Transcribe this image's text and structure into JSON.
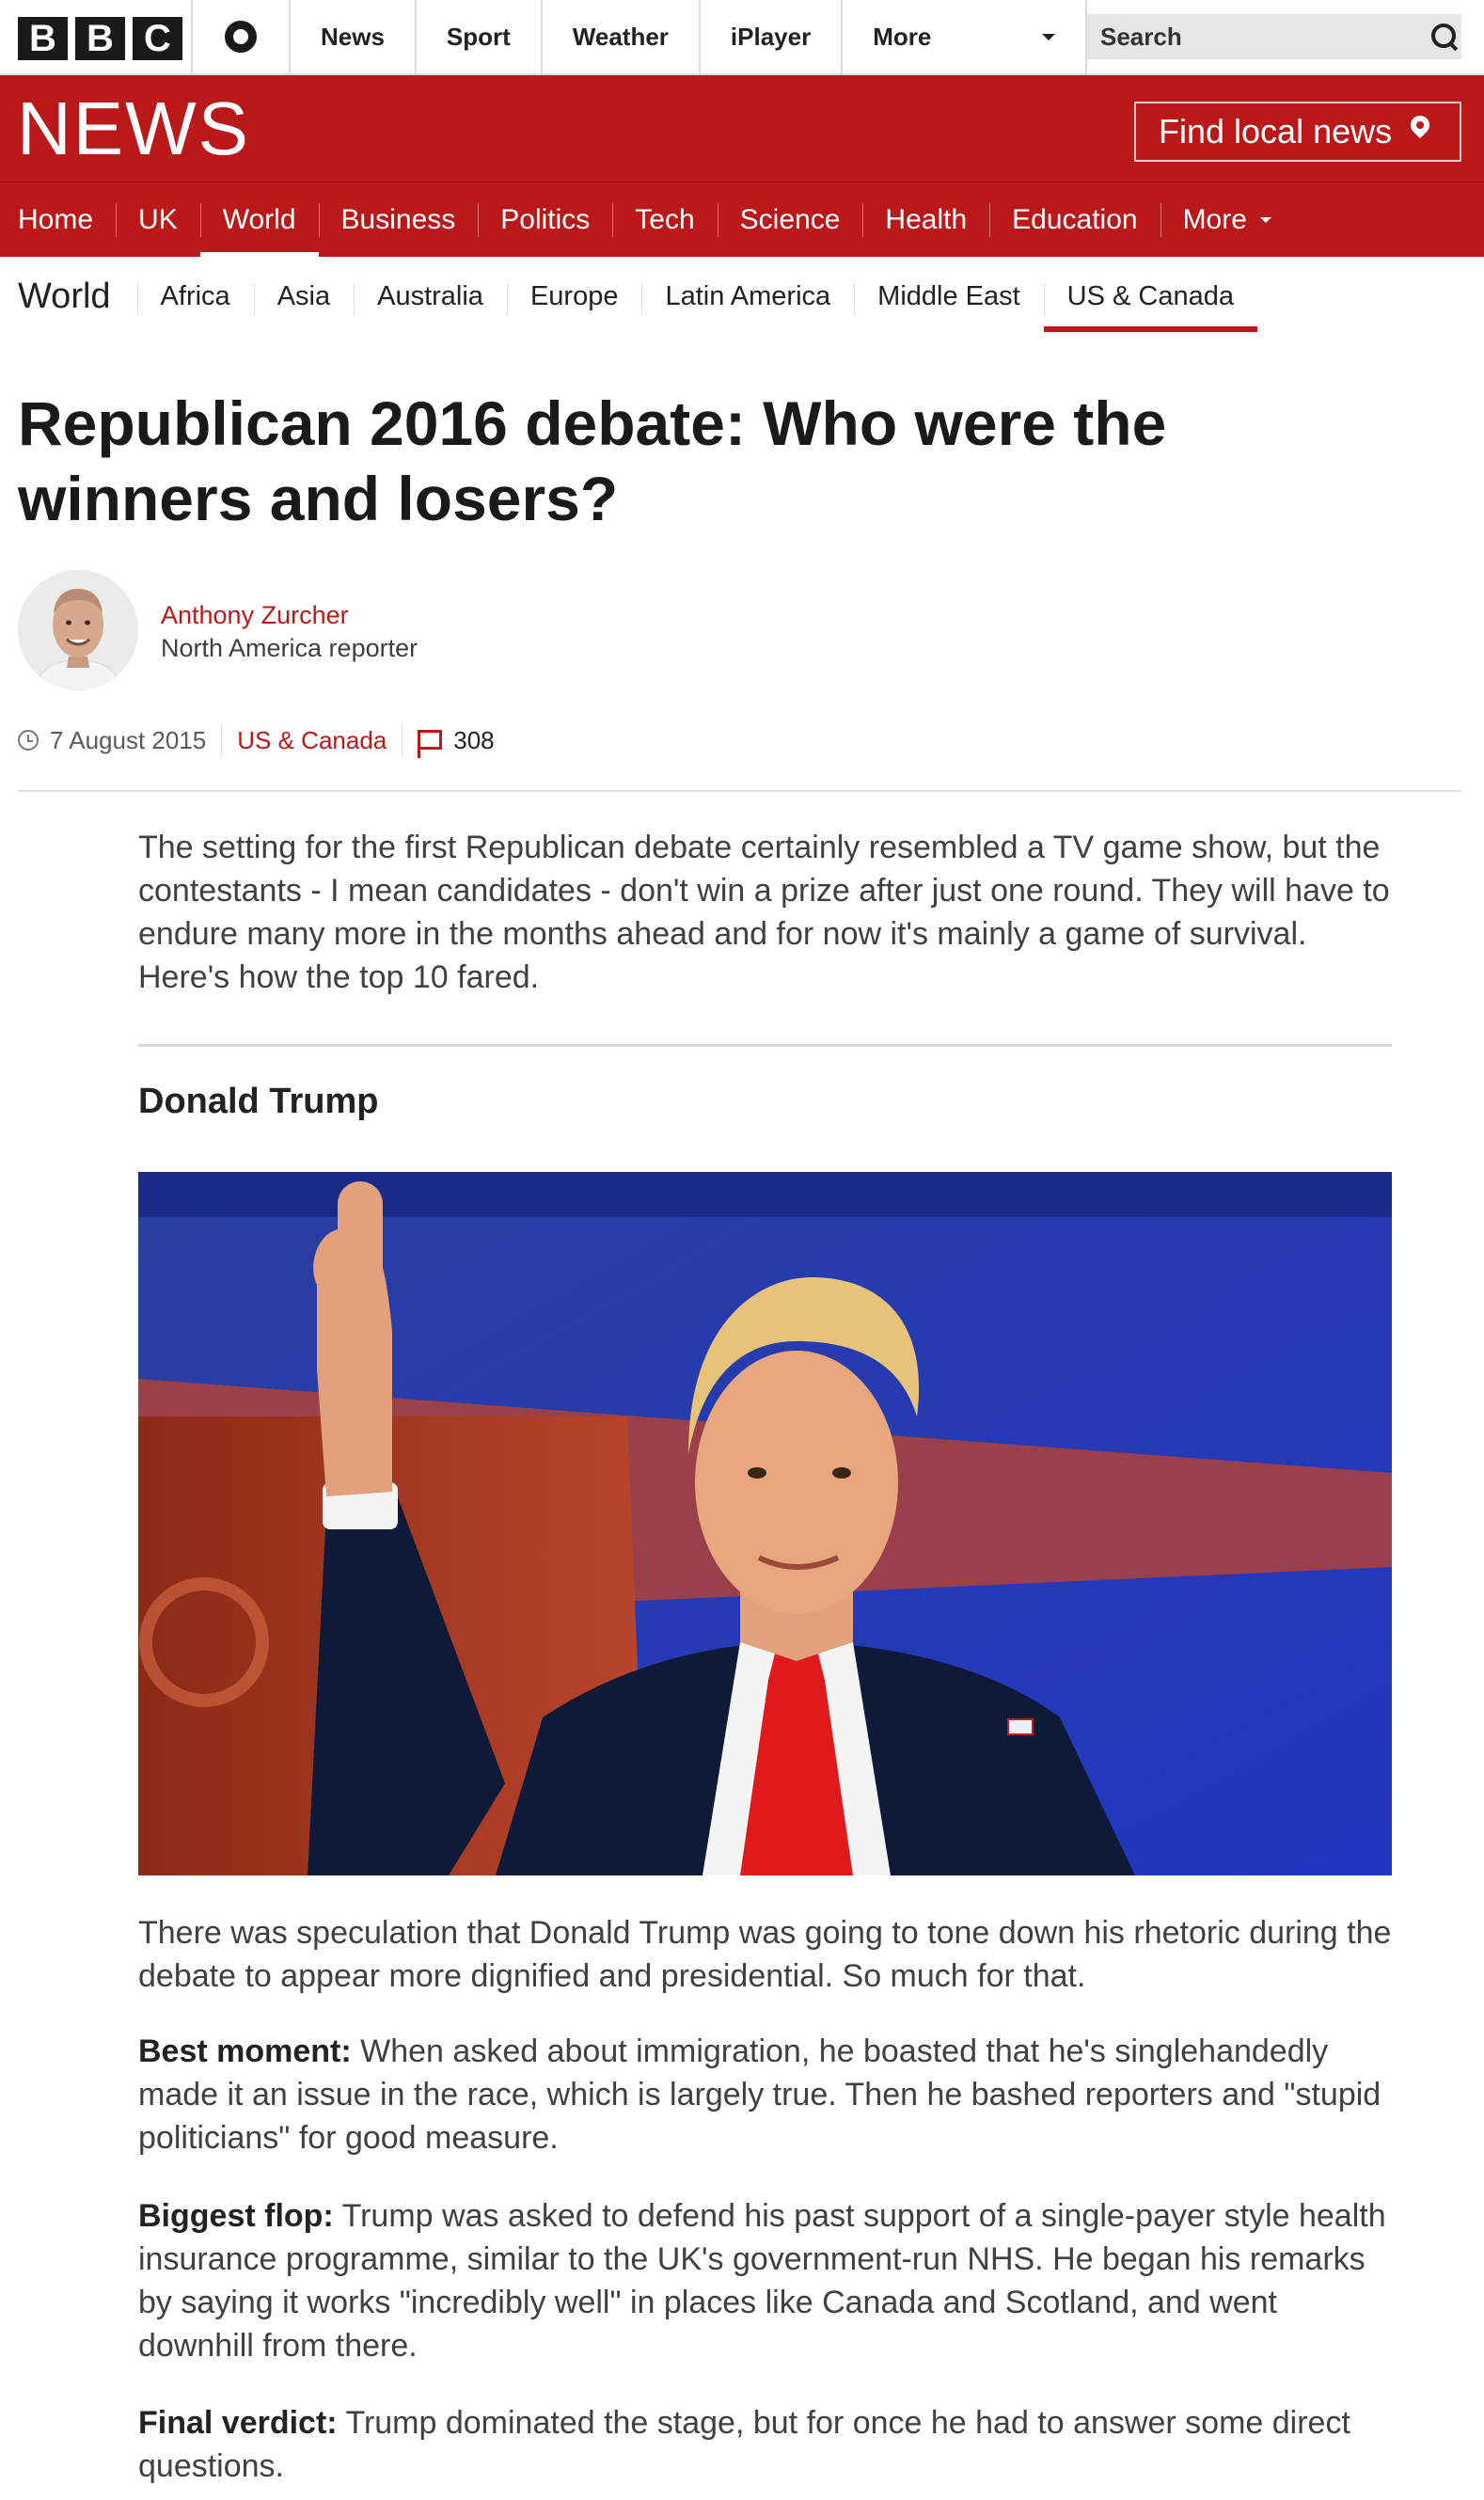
{
  "brand": {
    "blocks": [
      "B",
      "B",
      "C"
    ],
    "section_logo": "NEWS"
  },
  "topnav": {
    "items": [
      "News",
      "Sport",
      "Weather",
      "iPlayer"
    ],
    "more_label": "More"
  },
  "search": {
    "placeholder": "Search"
  },
  "local_news": {
    "label": "Find local news"
  },
  "sectionnav": {
    "items": [
      "Home",
      "UK",
      "World",
      "Business",
      "Politics",
      "Tech",
      "Science",
      "Health",
      "Education"
    ],
    "more_label": "More",
    "active": "World"
  },
  "subnav": {
    "title": "World",
    "items": [
      "Africa",
      "Asia",
      "Australia",
      "Europe",
      "Latin America",
      "Middle East",
      "US & Canada"
    ],
    "active": "US & Canada"
  },
  "article": {
    "headline": "Republican 2016 debate: Who were the winners and losers?",
    "author": {
      "name": "Anthony Zurcher",
      "role": "North America reporter"
    },
    "date": "7 August 2015",
    "section": "US & Canada",
    "comment_count": "308",
    "intro": "The setting for the first Republican debate certainly resembled a TV game show, but the contestants - I mean candidates - don't win a prize after just one round. They will have to endure many more in the months ahead and for now it's mainly a game of survival. Here's how the top 10 fared.",
    "candidate_heading": "Donald Trump",
    "paragraph_1": "There was speculation that Donald Trump was going to tone down his rhetoric during the debate to appear more dignified and presidential. So much for that.",
    "best_moment_label": "Best moment:",
    "best_moment_text": " When asked about immigration, he boasted that he's singlehandedly made it an issue in the race, which is largely true. Then he bashed reporters and \"stupid politicians\" for good measure.",
    "biggest_flop_label": "Biggest flop:",
    "biggest_flop_text": " Trump was asked to defend his past support of a single-payer style health insurance programme, similar to the UK's government-run NHS. He began his remarks by saying it works \"incredibly well\" in places like Canada and Scotland, and went downhill from there.",
    "final_verdict_label": "Final verdict:",
    "final_verdict_text": " Trump dominated the stage, but for once he had to answer some direct questions."
  },
  "colors": {
    "brand_red": "#bb1919",
    "text_dark": "#222222",
    "text_body": "#404040"
  },
  "icons": [
    "account-icon",
    "search-icon",
    "location-pin-icon",
    "clock-icon",
    "comment-icon"
  ]
}
